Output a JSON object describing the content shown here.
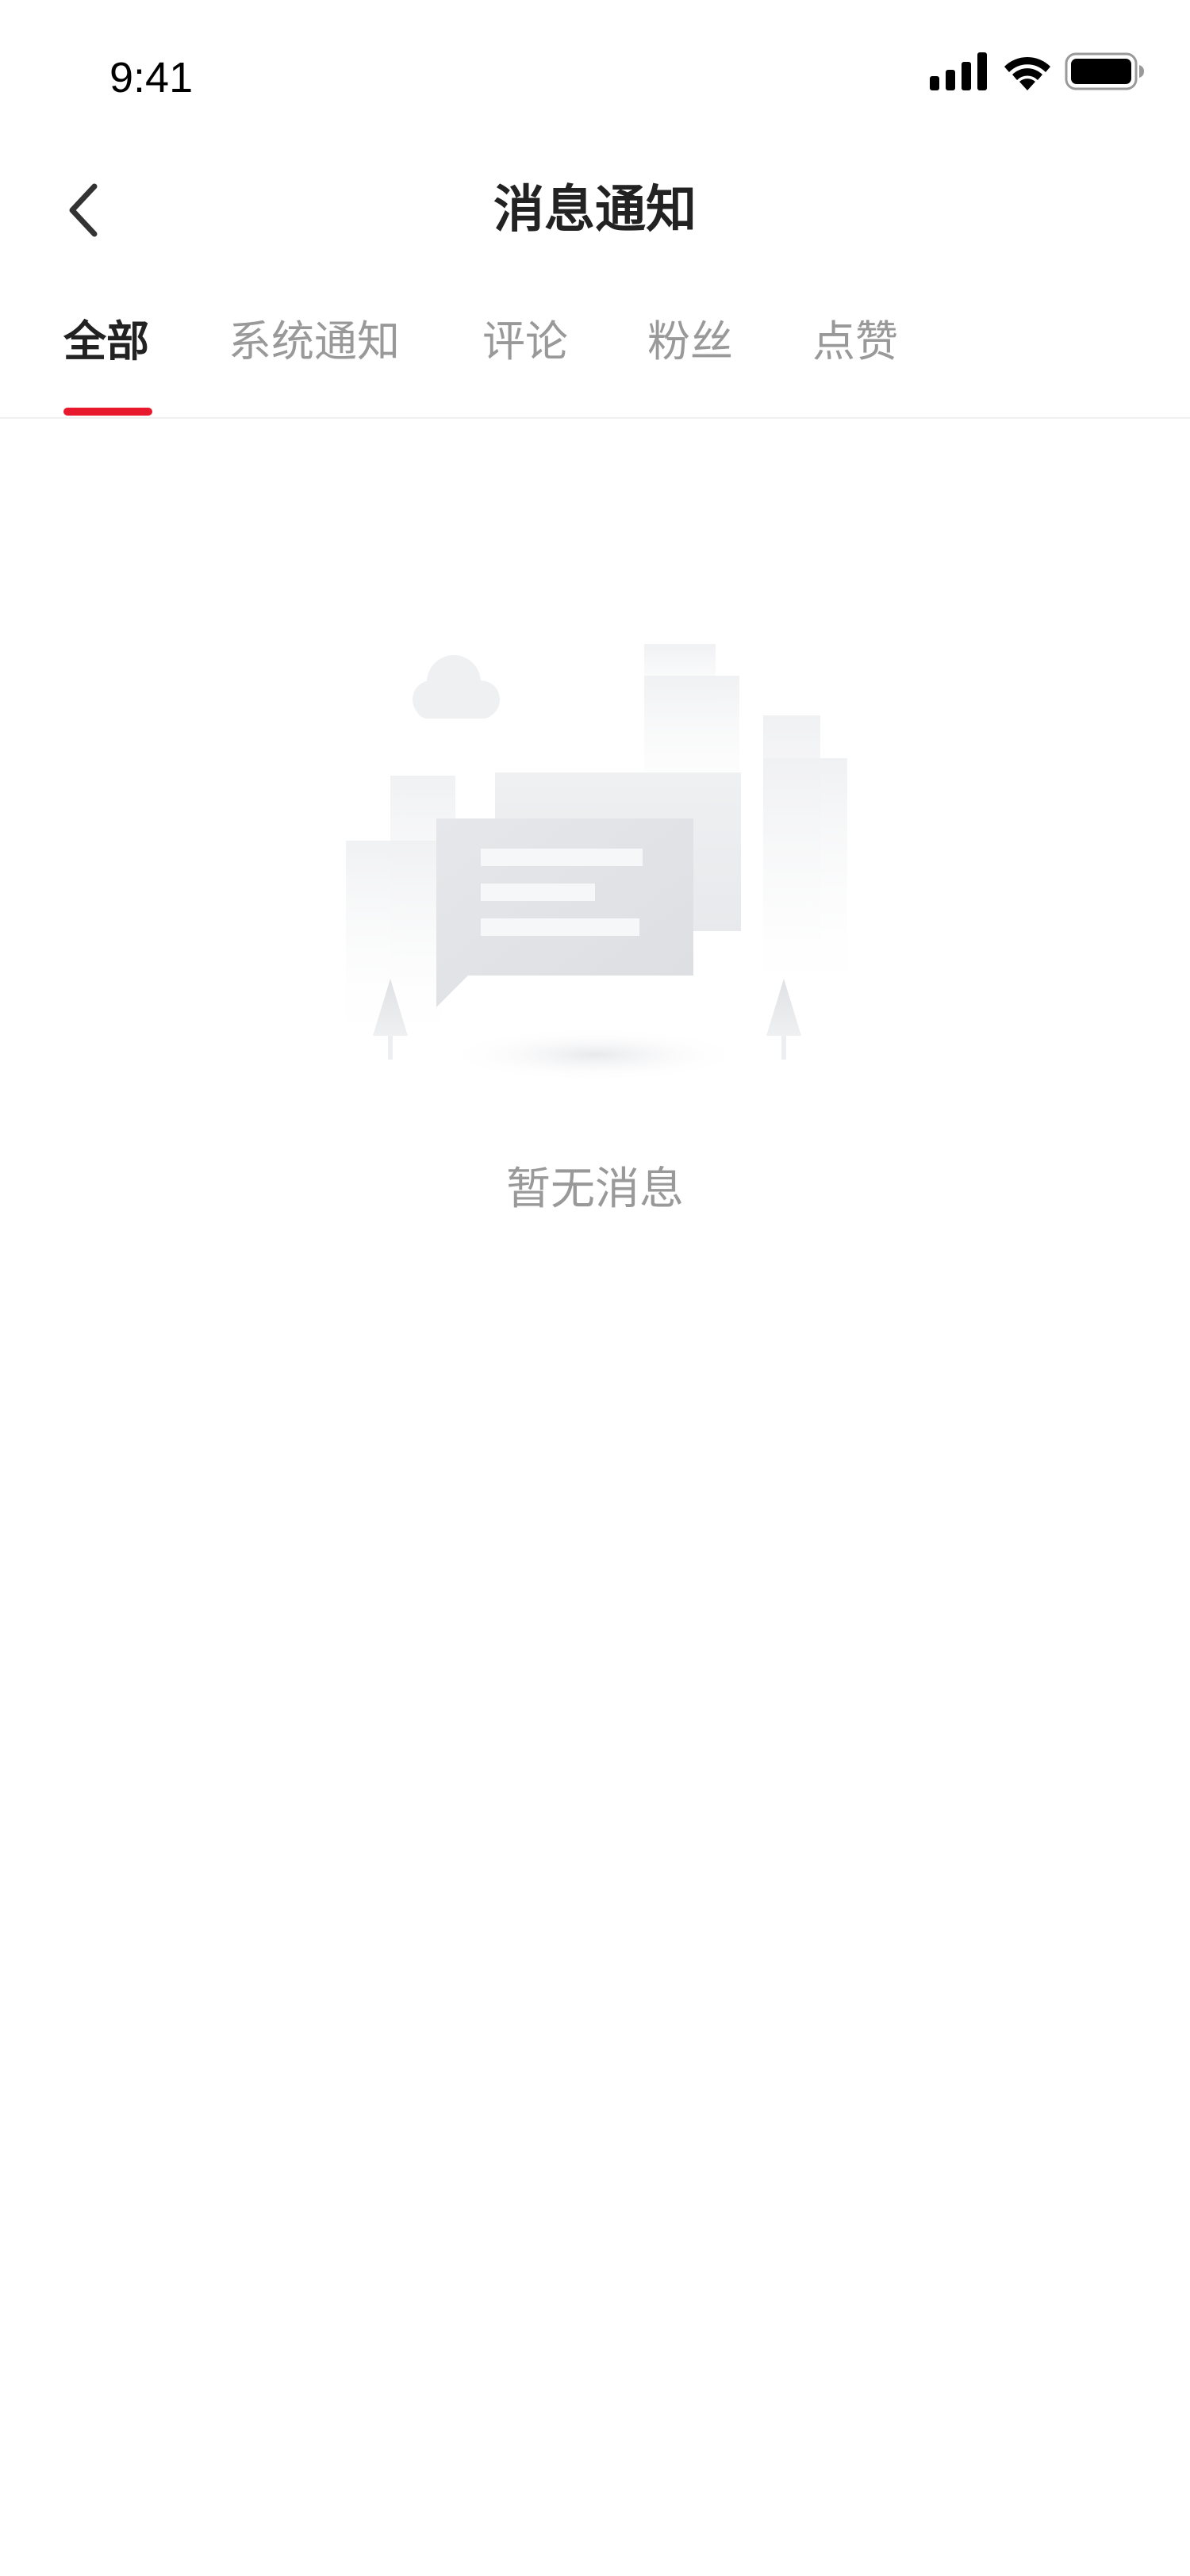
{
  "status_bar": {
    "time": "9:41"
  },
  "header": {
    "title": "消息通知",
    "back_icon": "chevron-left-icon"
  },
  "tabs": [
    {
      "label": "全部",
      "active": true
    },
    {
      "label": "系统通知",
      "active": false
    },
    {
      "label": "评论",
      "active": false
    },
    {
      "label": "粉丝",
      "active": false
    },
    {
      "label": "点赞",
      "active": false
    }
  ],
  "empty_state": {
    "message": "暂无消息",
    "illustration": "empty-messages-illustration"
  },
  "colors": {
    "accent": "#e8192c",
    "title_text": "#222222",
    "inactive_text": "#999999",
    "background": "#ffffff"
  }
}
